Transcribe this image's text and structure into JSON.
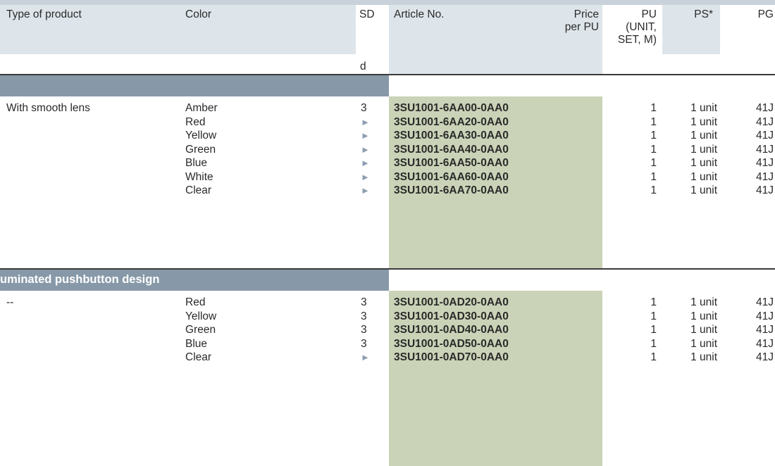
{
  "headers": {
    "type_of_product": "Type of product",
    "color": "Color",
    "sd": "SD",
    "sd_unit": "d",
    "article_no": "Article No.",
    "price_line1": "Price",
    "price_line2": "per PU",
    "pu_line1": "PU",
    "pu_line2": "(UNIT,",
    "pu_line3": "SET, M)",
    "ps": "PS*",
    "pg": "PG"
  },
  "sections": [
    {
      "title": "",
      "product_type": "With smooth lens",
      "rows": [
        {
          "color": "Amber",
          "sd": "3",
          "article": "3SU1001-6AA00-0AA0",
          "pu": "1",
          "ps": "1 unit",
          "pg": "41J"
        },
        {
          "color": "Red",
          "sd": "►",
          "article": "3SU1001-6AA20-0AA0",
          "pu": "1",
          "ps": "1 unit",
          "pg": "41J"
        },
        {
          "color": "Yellow",
          "sd": "►",
          "article": "3SU1001-6AA30-0AA0",
          "pu": "1",
          "ps": "1 unit",
          "pg": "41J"
        },
        {
          "color": "Green",
          "sd": "►",
          "article": "3SU1001-6AA40-0AA0",
          "pu": "1",
          "ps": "1 unit",
          "pg": "41J"
        },
        {
          "color": "Blue",
          "sd": "►",
          "article": "3SU1001-6AA50-0AA0",
          "pu": "1",
          "ps": "1 unit",
          "pg": "41J"
        },
        {
          "color": "White",
          "sd": "►",
          "article": "3SU1001-6AA60-0AA0",
          "pu": "1",
          "ps": "1 unit",
          "pg": "41J"
        },
        {
          "color": "Clear",
          "sd": "►",
          "article": "3SU1001-6AA70-0AA0",
          "pu": "1",
          "ps": "1 unit",
          "pg": "41J"
        }
      ]
    },
    {
      "title": "uminated pushbutton design",
      "product_type": "--",
      "rows": [
        {
          "color": "Red",
          "sd": "3",
          "article": "3SU1001-0AD20-0AA0",
          "pu": "1",
          "ps": "1 unit",
          "pg": "41J"
        },
        {
          "color": "Yellow",
          "sd": "3",
          "article": "3SU1001-0AD30-0AA0",
          "pu": "1",
          "ps": "1 unit",
          "pg": "41J"
        },
        {
          "color": "Green",
          "sd": "3",
          "article": "3SU1001-0AD40-0AA0",
          "pu": "1",
          "ps": "1 unit",
          "pg": "41J"
        },
        {
          "color": "Blue",
          "sd": "3",
          "article": "3SU1001-0AD50-0AA0",
          "pu": "1",
          "ps": "1 unit",
          "pg": "41J"
        },
        {
          "color": "Clear",
          "sd": "►",
          "article": "3SU1001-0AD70-0AA0",
          "pu": "1",
          "ps": "1 unit",
          "pg": "41J"
        }
      ]
    }
  ]
}
